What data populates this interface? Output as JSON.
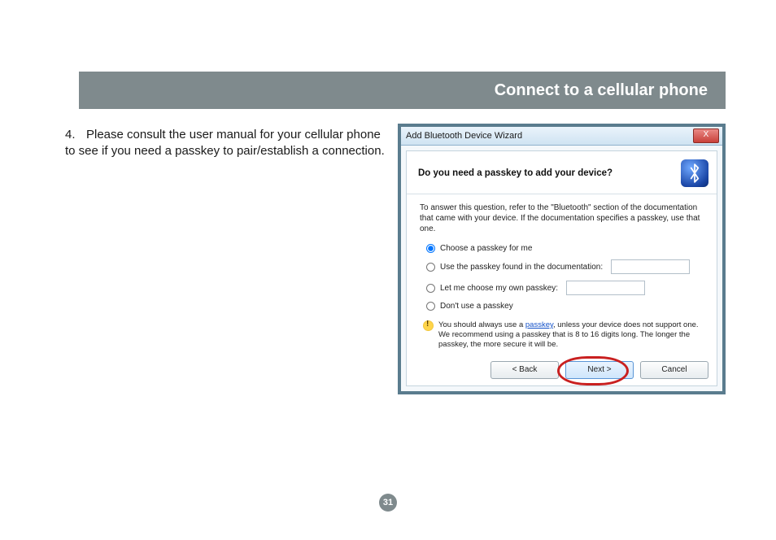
{
  "header": {
    "title": "Connect to a cellular phone"
  },
  "step": {
    "number": "4.",
    "text": "Please consult the user manual for your cellular phone to see if you need a passkey to pair/establish a connection."
  },
  "dialog": {
    "window_title": "Add Bluetooth Device Wizard",
    "close_label": "X",
    "heading": "Do you need a passkey to add your device?",
    "intro": "To answer this question, refer to the \"Bluetooth\" section of the documentation that came with your device. If the documentation specifies a passkey, use that one.",
    "options": {
      "choose": "Choose a passkey for me",
      "doc": "Use the passkey found in the documentation:",
      "own": "Let me choose my own passkey:",
      "none": "Don't use a passkey"
    },
    "note_pre": "You should always use a ",
    "note_link": "passkey",
    "note_post": ", unless your device does not support one. We recommend using a passkey that is 8 to 16 digits long. The longer the passkey, the more secure it will be.",
    "buttons": {
      "back": "< Back",
      "next": "Next >",
      "cancel": "Cancel"
    }
  },
  "page_number": "31"
}
